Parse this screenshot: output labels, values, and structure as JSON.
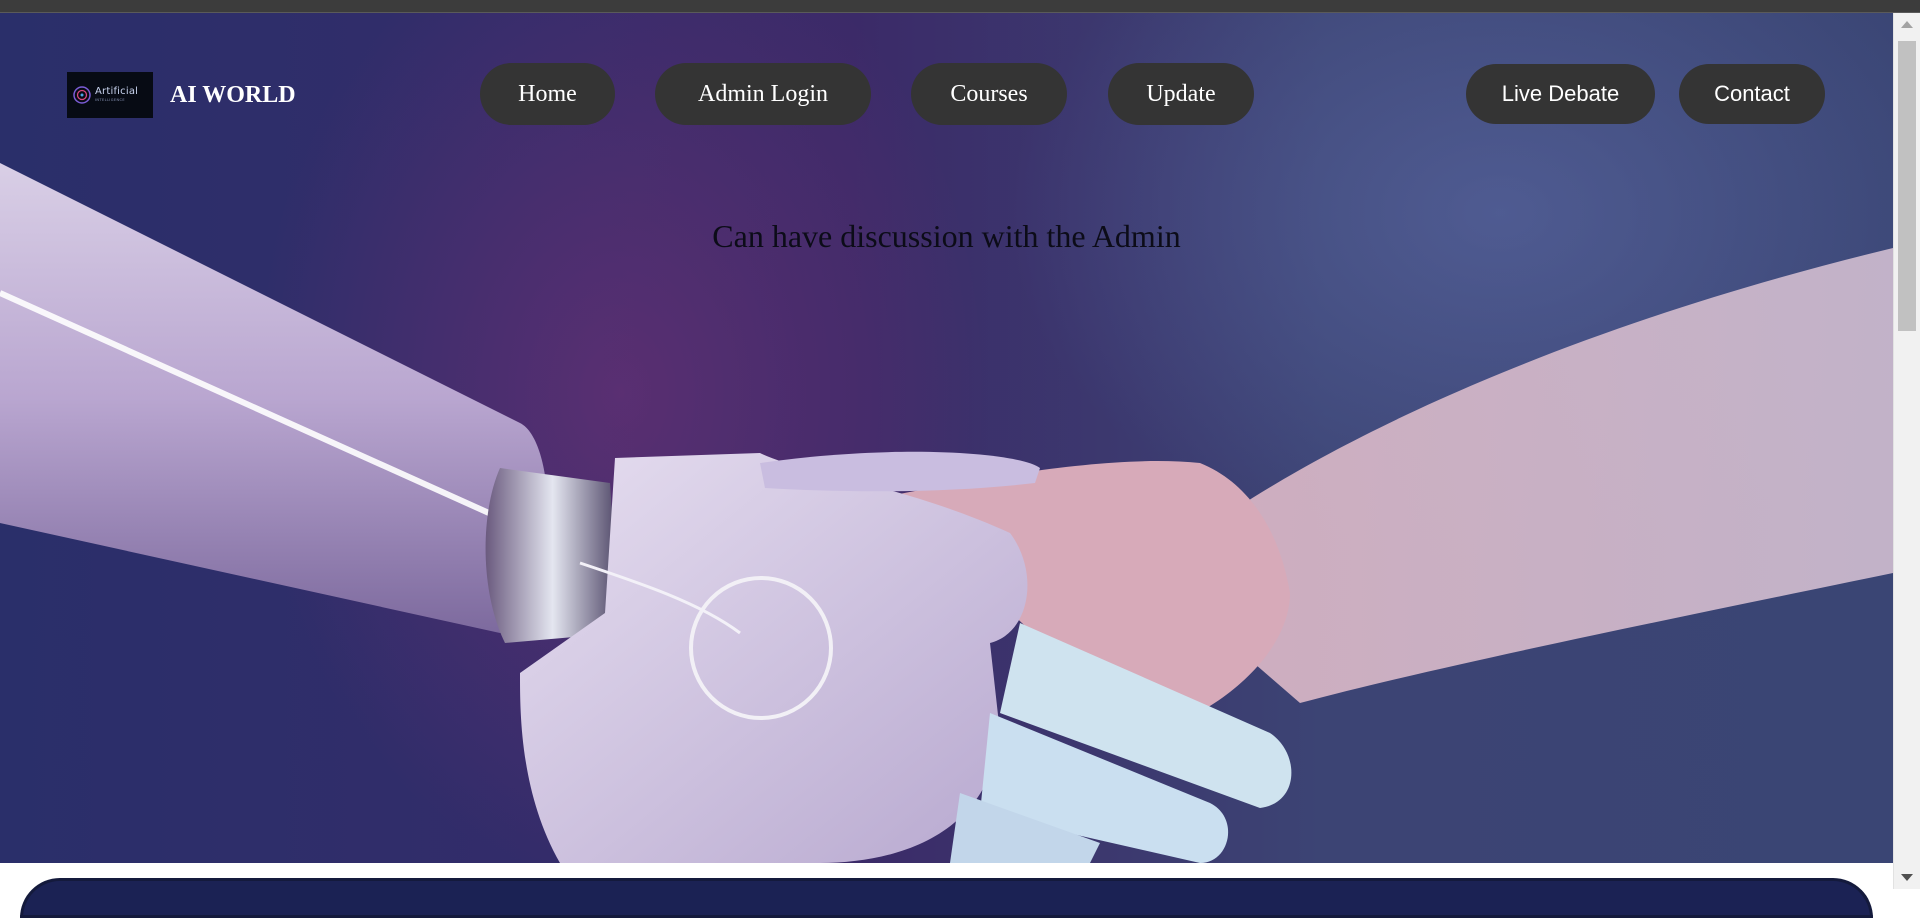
{
  "header": {
    "logo_text": "Artificial",
    "logo_subtext": "INTELLIGENCE",
    "brand_name": "AI WORLD"
  },
  "nav": {
    "home": "Home",
    "admin_login": "Admin Login",
    "courses": "Courses",
    "update": "Update",
    "live_debate": "Live Debate",
    "contact": "Contact"
  },
  "hero": {
    "text": "Can have discussion with the Admin",
    "image_icon": "robot-human-handshake-image"
  },
  "colors": {
    "nav_button_bg": "#343434",
    "nav_button_text": "#ffffff",
    "hero_text": "#0c0c18",
    "hero_bg": "#332c6a"
  }
}
